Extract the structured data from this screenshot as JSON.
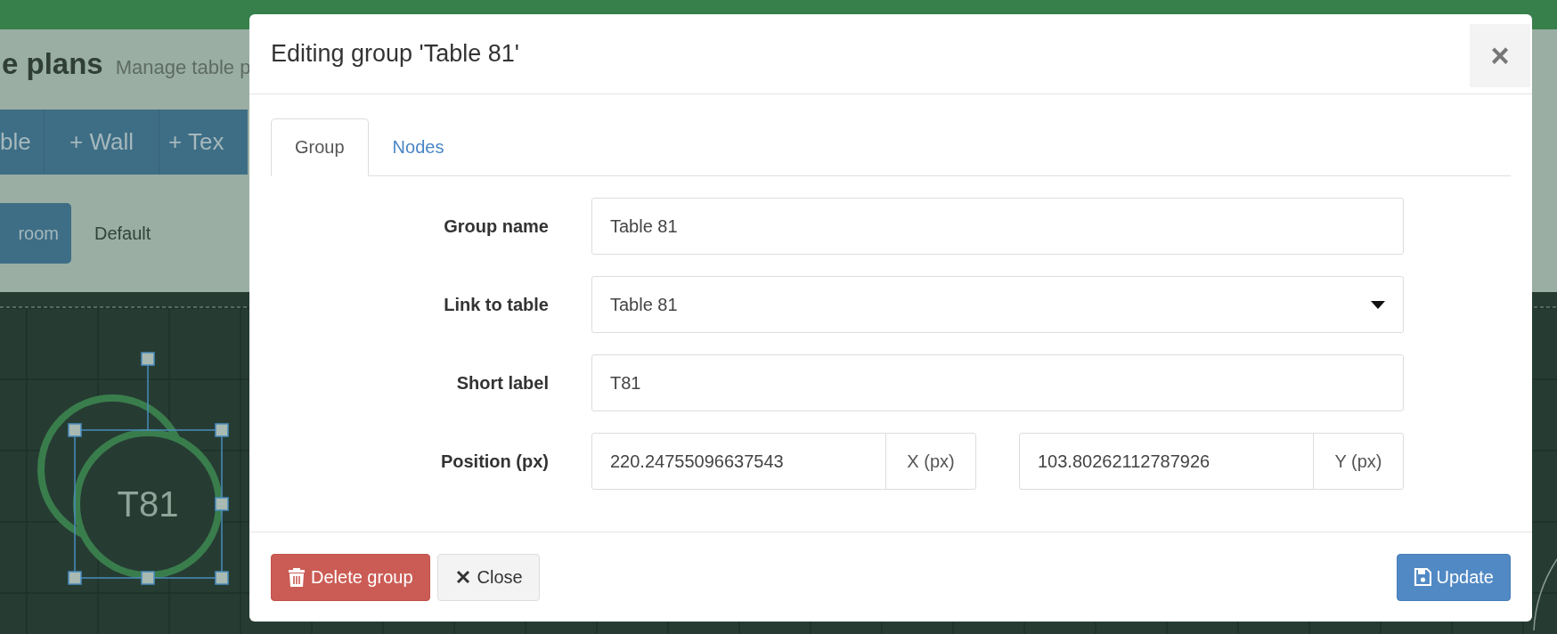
{
  "page": {
    "title": "e plans",
    "subtitle": "Manage table p",
    "toolbar": [
      "ble",
      "+ Wall",
      "+ Tex"
    ],
    "rooms": [
      {
        "label": "room",
        "selected": true
      },
      {
        "label": "Default",
        "selected": false
      }
    ],
    "canvas": {
      "tables": [
        {
          "label": "T81",
          "selected": true
        }
      ]
    }
  },
  "dialog": {
    "title": "Editing group 'Table 81'",
    "close": "×",
    "tabs": [
      {
        "label": "Group",
        "selected": true
      },
      {
        "label": "Nodes",
        "selected": false
      }
    ],
    "fields": [
      {
        "kind": "text",
        "label": "Group name",
        "value": "Table 81"
      },
      {
        "kind": "select",
        "label": "Link to table",
        "value": "Table 81"
      },
      {
        "kind": "text",
        "label": "Short label",
        "value": "T81"
      },
      {
        "kind": "pair",
        "label": "Position (px)",
        "values": [
          {
            "value": "220.24755096637543",
            "addon": "X (px)"
          },
          {
            "value": "103.80262112787926",
            "addon": "Y (px)"
          }
        ]
      }
    ],
    "buttons": [
      {
        "kind": "danger",
        "label": "Delete group"
      },
      {
        "kind": "default",
        "label": "Close"
      },
      {
        "kind": "primary",
        "label": "Update"
      }
    ]
  }
}
